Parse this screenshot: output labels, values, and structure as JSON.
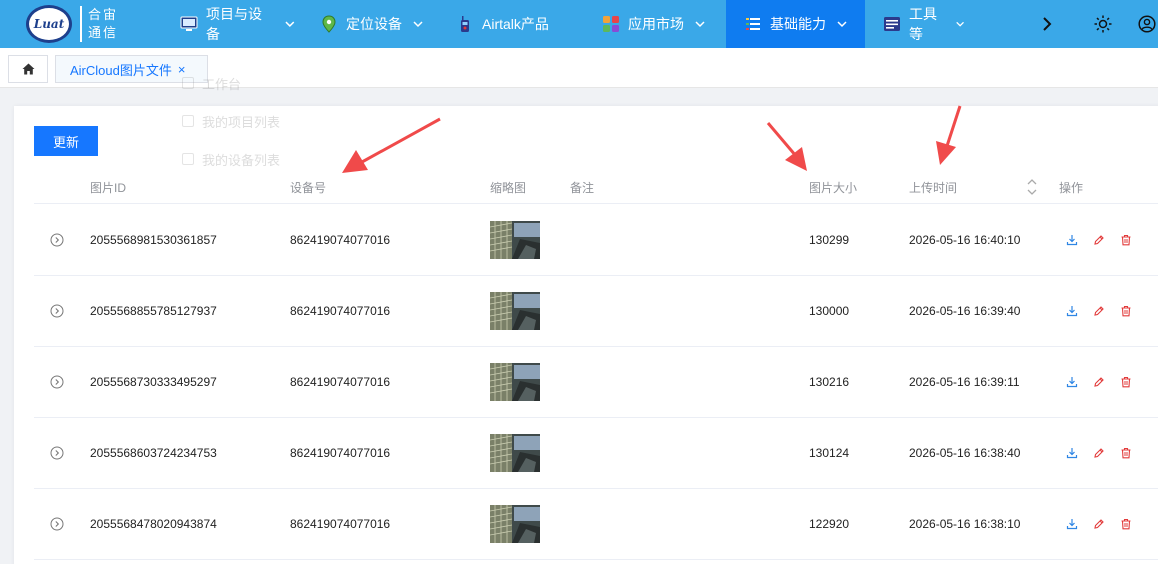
{
  "logo": {
    "badge": "Luat",
    "line1": "合宙",
    "line2": "通信"
  },
  "nav": {
    "items": [
      {
        "label": "项目与设备",
        "icon": "monitor-icon"
      },
      {
        "label": "定位设备",
        "icon": "location-pin-icon"
      },
      {
        "label": "Airtalk产品",
        "icon": "walkie-talkie-icon"
      },
      {
        "label": "应用市场",
        "icon": "app-grid-icon"
      },
      {
        "label": "基础能力",
        "icon": "list-icon",
        "active": true
      },
      {
        "label": "工具等",
        "icon": "tools-icon"
      }
    ],
    "right": [
      "chevron-right-icon",
      "sun-icon",
      "user-circle-icon"
    ]
  },
  "tabs": {
    "home_icon": "home-icon",
    "current": "AirCloud图片文件",
    "close": "×"
  },
  "ghost_menu": [
    "工作台",
    "我的项目列表",
    "我的设备列表"
  ],
  "toolbar": {
    "refresh_label": "更新"
  },
  "table": {
    "columns": {
      "image_id": "图片ID",
      "device": "设备号",
      "thumbnail": "缩略图",
      "remark": "备注",
      "size": "图片大小",
      "upload_time": "上传时间",
      "actions": "操作"
    },
    "rows": [
      {
        "image_id": "2055568981530361857",
        "device": "862419074077016",
        "remark": "",
        "size": "130299",
        "upload_time": "2026-05-16 16:40:10"
      },
      {
        "image_id": "2055568855785127937",
        "device": "862419074077016",
        "remark": "",
        "size": "130000",
        "upload_time": "2026-05-16 16:39:40"
      },
      {
        "image_id": "2055568730333495297",
        "device": "862419074077016",
        "remark": "",
        "size": "130216",
        "upload_time": "2026-05-16 16:39:11"
      },
      {
        "image_id": "2055568603724234753",
        "device": "862419074077016",
        "remark": "",
        "size": "130124",
        "upload_time": "2026-05-16 16:38:40"
      },
      {
        "image_id": "2055568478020943874",
        "device": "862419074077016",
        "remark": "",
        "size": "122920",
        "upload_time": "2026-05-16 16:38:10"
      }
    ]
  },
  "colors": {
    "nav_bg": "#3aa8e8",
    "nav_active": "#0f7cf0",
    "primary": "#1677ff",
    "action_blue": "#2f86e4",
    "action_red": "#e23b3b",
    "arrow": "#f04a4a"
  }
}
